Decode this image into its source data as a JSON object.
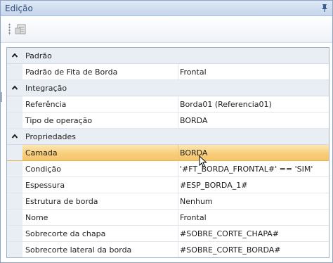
{
  "panel": {
    "title": "Edição",
    "icons": {
      "pin": "pin-icon",
      "toolbar_button": "property-pages-icon",
      "collapse": "chevron-up-icon"
    }
  },
  "categories": [
    {
      "label": "Padrão",
      "rows": [
        {
          "name": "Padrão de Fita de Borda",
          "value": "Frontal",
          "selected": false
        }
      ]
    },
    {
      "label": "Integração",
      "rows": [
        {
          "name": "Referência",
          "value": "Borda01 (Referencia01)",
          "selected": false
        },
        {
          "name": "Tipo de operação",
          "value": "BORDA",
          "selected": false
        }
      ]
    },
    {
      "label": "Propriedades",
      "rows": [
        {
          "name": "Camada",
          "value": "BORDA",
          "selected": true
        },
        {
          "name": "Condição",
          "value": "'#FT_BORDA_FRONTAL#' == 'SIM'",
          "selected": false
        },
        {
          "name": "Espessura",
          "value": "#ESP_BORDA_1#",
          "selected": false
        },
        {
          "name": "Estrutura de borda",
          "value": "Nenhum",
          "selected": false
        },
        {
          "name": "Nome",
          "value": "Frontal",
          "selected": false
        },
        {
          "name": "Sobrecorte da chapa",
          "value": "#SOBRE_CORTE_CHAPA#",
          "selected": false
        },
        {
          "name": "Sobrecorte lateral da borda",
          "value": "#SOBRE_CORTE_BORDA#",
          "selected": false
        }
      ]
    }
  ],
  "colors": {
    "selection": "#f8cf7b",
    "category_bg": "#e9eef5",
    "title_text": "#2b4a78"
  }
}
